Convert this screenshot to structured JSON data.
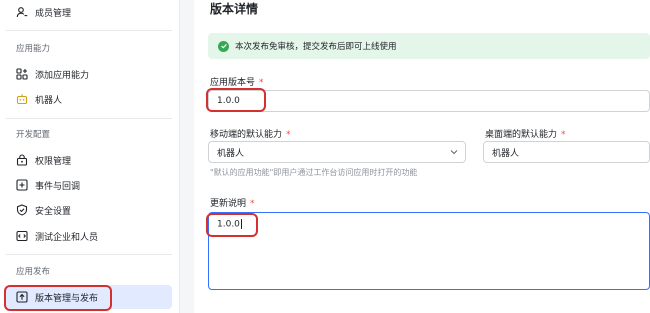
{
  "sidebar": {
    "members_label": "成员管理",
    "section_app_ability": "应用能力",
    "add_ability_label": "添加应用能力",
    "bot_label": "机器人",
    "section_dev_config": "开发配置",
    "permissions_label": "权限管理",
    "events_label": "事件与回调",
    "security_label": "安全设置",
    "test_label": "测试企业和人员",
    "section_publish": "应用发布",
    "version_label": "版本管理与发布"
  },
  "main": {
    "title": "版本详情",
    "notice": "本次发布免审核，提交发布后即可上线使用",
    "version_label": "应用版本号",
    "version_value": "1.0.0",
    "mobile_label": "移动端的默认能力",
    "mobile_value": "机器人",
    "desktop_label": "桌面端的默认能力",
    "desktop_value": "机器人",
    "hint": "\"默认的应用功能\"即用户通过工作台访问应用时打开的功能",
    "changelog_label": "更新说明",
    "changelog_value": "1.0.0",
    "required_mark": "*"
  },
  "colors": {
    "accent": "#3370ff",
    "active_bg": "#e1eaff",
    "success": "#34a853",
    "notice_bg": "#e4f5e9",
    "annotation": "#d43030",
    "required": "#f54a45"
  }
}
